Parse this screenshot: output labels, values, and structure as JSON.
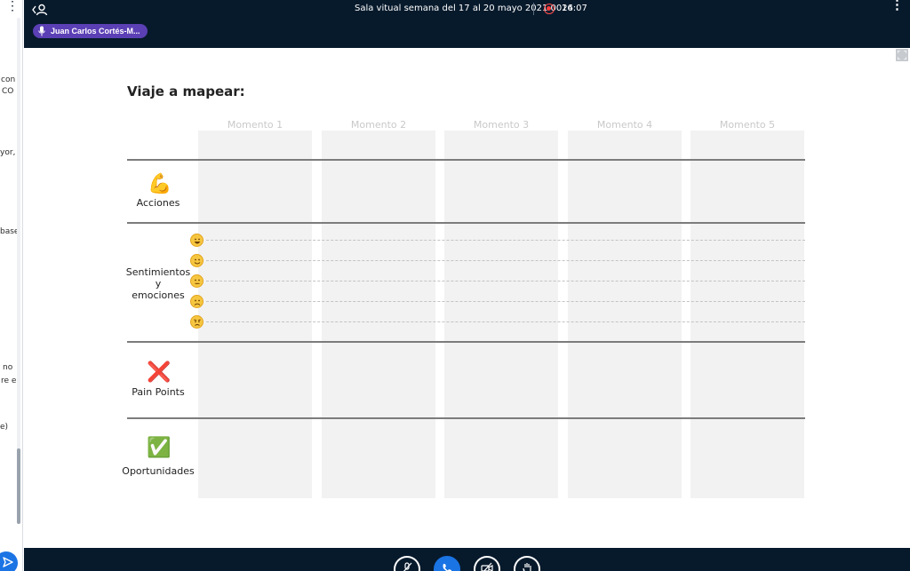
{
  "sidebar": {
    "fragments": [
      "con",
      "CO",
      "yor,",
      "base",
      "no",
      "re el",
      "e)"
    ],
    "icons": {
      "menu": "kebab-icon",
      "send": "send-icon"
    }
  },
  "topbar": {
    "meeting_title": "Sala vitual semana del 17 al 20 mayo 2021 0024",
    "time": "16:07",
    "speaker": "Juan Carlos Cortés-M...",
    "colors": {
      "bar": "#071a2c",
      "speaker_chip": "#5b3fb5",
      "recording": "#ff3b3b"
    }
  },
  "slide": {
    "heading": "Viaje a mapear:",
    "columns": [
      "Momento 1",
      "Momento 2",
      "Momento 3",
      "Momento 4",
      "Momento 5"
    ],
    "rows": {
      "acciones": {
        "icon": "💪",
        "label": "Acciones"
      },
      "sentimientos": {
        "label_lines": [
          "Sentimientos",
          "y",
          "emociones"
        ],
        "emotion_scale": [
          "very-happy-face-icon",
          "happy-face-icon",
          "neutral-face-icon",
          "sad-face-icon",
          "angry-face-icon"
        ]
      },
      "pain_points": {
        "icon": "❌",
        "label": "Pain Points"
      },
      "oportunidades": {
        "icon": "✅",
        "label": "Oportunidades"
      }
    }
  },
  "controls": {
    "buttons": [
      "mute-microphone-icon",
      "phone-icon",
      "camera-off-icon",
      "raise-hand-icon"
    ],
    "accent": "#1b74e4"
  }
}
